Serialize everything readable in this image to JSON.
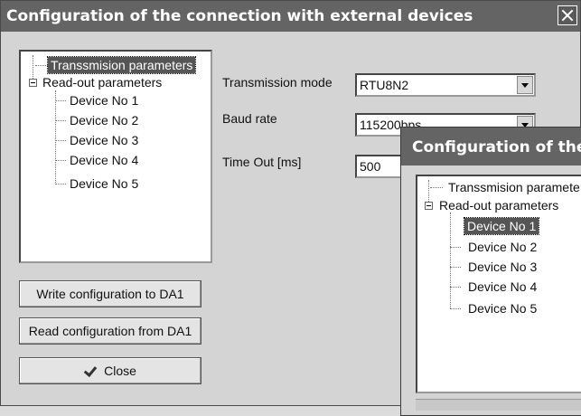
{
  "main_window": {
    "title": "Configuration of the connection with external devices",
    "tree": {
      "items": [
        {
          "label": "Transsmision parameters",
          "selected": true
        },
        {
          "label": "Read-out parameters",
          "expanded": true
        },
        {
          "label": "Device No 1"
        },
        {
          "label": "Device No 2"
        },
        {
          "label": "Device No 3"
        },
        {
          "label": "Device No 4"
        },
        {
          "label": "Device No 5"
        }
      ]
    },
    "buttons": {
      "write": "Write configuration to DA1",
      "read": "Read configuration from DA1",
      "close": "Close"
    },
    "fields": {
      "mode_label": "Transmission mode",
      "mode_value": "RTU8N2",
      "baud_label": "Baud rate",
      "baud_value": "115200bps",
      "timeout_label": "Time Out [ms]",
      "timeout_value": "500"
    }
  },
  "overlay_window": {
    "title": "Configuration of the c",
    "tree": {
      "items": [
        {
          "label": "Transsmision paramete"
        },
        {
          "label": "Read-out parameters",
          "expanded": true
        },
        {
          "label": "Device No 1",
          "selected": true
        },
        {
          "label": "Device No 2"
        },
        {
          "label": "Device No 3"
        },
        {
          "label": "Device No 4"
        },
        {
          "label": "Device No 5"
        }
      ]
    }
  }
}
